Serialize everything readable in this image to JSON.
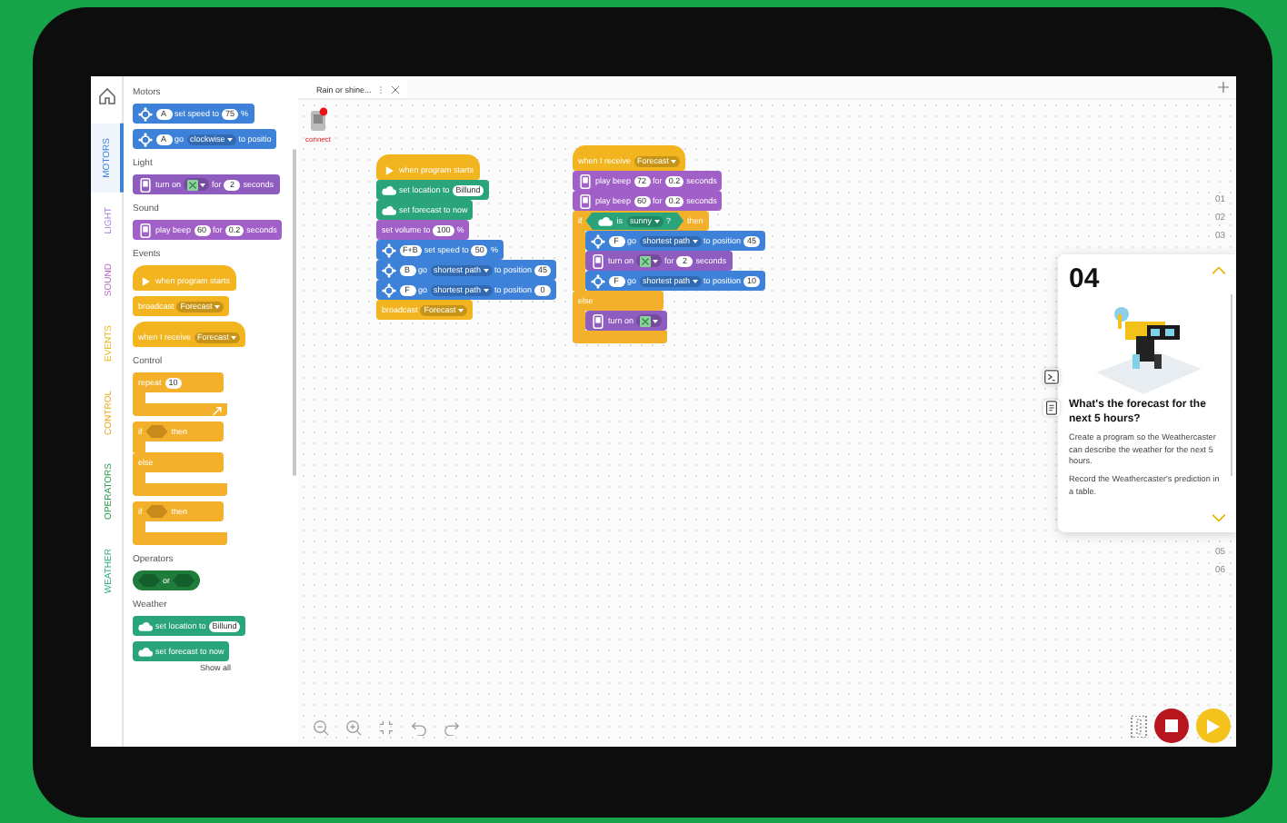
{
  "tab": {
    "title": "Rain or shine..."
  },
  "categories": [
    {
      "label": "MOTORS",
      "selected": true
    },
    {
      "label": "LIGHT",
      "selected": false
    },
    {
      "label": "SOUND",
      "selected": false
    },
    {
      "label": "EVENTS",
      "selected": false
    },
    {
      "label": "CONTROL",
      "selected": false
    },
    {
      "label": "OPERATORS",
      "selected": false
    },
    {
      "label": "WEATHER",
      "selected": false
    }
  ],
  "palette": [
    {
      "title": "Motors",
      "blocks": [
        {
          "kind": "motor",
          "parts": [
            {
              "kind": "icon"
            },
            {
              "kind": "pill",
              "v": "A"
            },
            {
              "kind": "text",
              "v": "set speed to"
            },
            {
              "kind": "pill",
              "v": "75"
            },
            {
              "kind": "text",
              "v": "%"
            }
          ]
        },
        {
          "kind": "motor",
          "parts": [
            {
              "kind": "icon"
            },
            {
              "kind": "pill",
              "v": "A"
            },
            {
              "kind": "text",
              "v": "go"
            },
            {
              "kind": "dd",
              "v": "clockwise"
            },
            {
              "kind": "text",
              "v": "to positio"
            }
          ]
        }
      ]
    },
    {
      "title": "Light",
      "blocks": [
        {
          "kind": "light",
          "parts": [
            {
              "kind": "icon"
            },
            {
              "kind": "text",
              "v": "turn on"
            },
            {
              "kind": "matrix"
            },
            {
              "kind": "text",
              "v": "for"
            },
            {
              "kind": "pill",
              "v": "2"
            },
            {
              "kind": "text",
              "v": "seconds"
            }
          ]
        }
      ]
    },
    {
      "title": "Sound",
      "blocks": [
        {
          "kind": "sound",
          "parts": [
            {
              "kind": "icon"
            },
            {
              "kind": "text",
              "v": "play beep"
            },
            {
              "kind": "pill",
              "v": "60"
            },
            {
              "kind": "text",
              "v": "for"
            },
            {
              "kind": "pill",
              "v": "0.2"
            },
            {
              "kind": "text",
              "v": "seconds"
            }
          ]
        }
      ]
    },
    {
      "title": "Events",
      "blocks": [
        {
          "kind": "hat",
          "parts": [
            {
              "kind": "icon"
            },
            {
              "kind": "text",
              "v": "when program starts"
            }
          ]
        },
        {
          "kind": "event",
          "parts": [
            {
              "kind": "text",
              "v": "broadcast"
            },
            {
              "kind": "dd",
              "v": "Forecast"
            }
          ]
        },
        {
          "kind": "hat",
          "parts": [
            {
              "kind": "text",
              "v": "when I receive"
            },
            {
              "kind": "dd",
              "v": "Forecast"
            }
          ]
        }
      ]
    },
    {
      "title": "Control",
      "blocks": [
        {
          "kind": "c",
          "parts": [
            {
              "kind": "text",
              "v": "repeat"
            },
            {
              "kind": "pill",
              "v": "10"
            }
          ],
          "foot": [
            {
              "kind": "loop"
            }
          ]
        },
        {
          "kind": "c",
          "parts": [
            {
              "kind": "text",
              "v": "if"
            },
            {
              "kind": "hex"
            },
            {
              "kind": "text",
              "v": "then"
            }
          ],
          "else": {
            "parts": [
              {
                "kind": "text",
                "v": "else"
              }
            ]
          }
        },
        {
          "kind": "c",
          "parts": [
            {
              "kind": "text",
              "v": "if"
            },
            {
              "kind": "hex"
            },
            {
              "kind": "text",
              "v": "then"
            }
          ]
        }
      ]
    },
    {
      "title": "Operators",
      "blocks": [
        {
          "kind": "operator",
          "parts": [
            {
              "kind": "hex"
            },
            {
              "kind": "text",
              "v": "or"
            },
            {
              "kind": "hex"
            }
          ]
        }
      ]
    },
    {
      "title": "Weather",
      "blocks": [
        {
          "kind": "weather",
          "parts": [
            {
              "kind": "icon"
            },
            {
              "kind": "text",
              "v": "set location to"
            },
            {
              "kind": "pill",
              "v": "Billund"
            }
          ]
        },
        {
          "kind": "weather",
          "parts": [
            {
              "kind": "icon"
            },
            {
              "kind": "text",
              "v": "set forecast to now"
            }
          ]
        }
      ]
    }
  ],
  "show_all": "Show all",
  "connect": {
    "label": "connect"
  },
  "stacks": [
    [
      {
        "kind": "hat",
        "parts": [
          {
            "kind": "icon"
          },
          {
            "kind": "text",
            "v": "when program starts"
          }
        ]
      },
      {
        "kind": "weather",
        "parts": [
          {
            "kind": "icon"
          },
          {
            "kind": "text",
            "v": "set location to"
          },
          {
            "kind": "pill",
            "v": "Billund"
          }
        ]
      },
      {
        "kind": "weather",
        "parts": [
          {
            "kind": "icon"
          },
          {
            "kind": "text",
            "v": "set forecast to now"
          }
        ]
      },
      {
        "kind": "sound",
        "parts": [
          {
            "kind": "text",
            "v": "set volume to"
          },
          {
            "kind": "pill",
            "v": "100"
          },
          {
            "kind": "text",
            "v": "%"
          }
        ]
      },
      {
        "kind": "motor",
        "parts": [
          {
            "kind": "icon"
          },
          {
            "kind": "pill",
            "v": "F+B"
          },
          {
            "kind": "text",
            "v": "set speed to"
          },
          {
            "kind": "pill",
            "v": "50"
          },
          {
            "kind": "text",
            "v": "%"
          }
        ]
      },
      {
        "kind": "motor",
        "parts": [
          {
            "kind": "icon"
          },
          {
            "kind": "pill",
            "v": "B"
          },
          {
            "kind": "text",
            "v": "go"
          },
          {
            "kind": "dd",
            "v": "shortest path"
          },
          {
            "kind": "text",
            "v": "to position"
          },
          {
            "kind": "pill",
            "v": "45"
          }
        ]
      },
      {
        "kind": "motor",
        "parts": [
          {
            "kind": "icon"
          },
          {
            "kind": "pill",
            "v": "F"
          },
          {
            "kind": "text",
            "v": "go"
          },
          {
            "kind": "dd",
            "v": "shortest path"
          },
          {
            "kind": "text",
            "v": "to position"
          },
          {
            "kind": "pill",
            "v": "0"
          }
        ]
      },
      {
        "kind": "event",
        "parts": [
          {
            "kind": "text",
            "v": "broadcast"
          },
          {
            "kind": "dd",
            "v": "Forecast"
          }
        ]
      }
    ],
    [
      {
        "kind": "hat",
        "parts": [
          {
            "kind": "text",
            "v": "when I receive"
          },
          {
            "kind": "dd",
            "v": "Forecast"
          }
        ]
      },
      {
        "kind": "sound",
        "parts": [
          {
            "kind": "icon"
          },
          {
            "kind": "text",
            "v": "play beep"
          },
          {
            "kind": "pill",
            "v": "72"
          },
          {
            "kind": "text",
            "v": "for"
          },
          {
            "kind": "pill",
            "v": "0.2"
          },
          {
            "kind": "text",
            "v": "seconds"
          }
        ]
      },
      {
        "kind": "sound",
        "parts": [
          {
            "kind": "icon"
          },
          {
            "kind": "text",
            "v": "play beep"
          },
          {
            "kind": "pill",
            "v": "60"
          },
          {
            "kind": "text",
            "v": "for"
          },
          {
            "kind": "pill",
            "v": "0.2"
          },
          {
            "kind": "text",
            "v": "seconds"
          }
        ]
      },
      {
        "kind": "c",
        "parts": [
          {
            "kind": "text",
            "v": "if"
          },
          {
            "kind": "hex",
            "condition": {
              "kind": "weather",
              "parts": [
                {
                  "kind": "icon"
                },
                {
                  "kind": "text",
                  "v": "is"
                },
                {
                  "kind": "dd",
                  "v": "sunny"
                },
                {
                  "kind": "text",
                  "v": "?"
                }
              ]
            }
          },
          {
            "kind": "text",
            "v": "then"
          }
        ],
        "body": [
          {
            "kind": "motor",
            "parts": [
              {
                "kind": "icon"
              },
              {
                "kind": "pill",
                "v": "F"
              },
              {
                "kind": "text",
                "v": "go"
              },
              {
                "kind": "dd",
                "v": "shortest path"
              },
              {
                "kind": "text",
                "v": "to position"
              },
              {
                "kind": "pill",
                "v": "45"
              }
            ]
          },
          {
            "kind": "light",
            "parts": [
              {
                "kind": "icon"
              },
              {
                "kind": "text",
                "v": "turn on"
              },
              {
                "kind": "matrix"
              },
              {
                "kind": "text",
                "v": "for"
              },
              {
                "kind": "pill",
                "v": "2"
              },
              {
                "kind": "text",
                "v": "seconds"
              }
            ]
          },
          {
            "kind": "motor",
            "parts": [
              {
                "kind": "icon"
              },
              {
                "kind": "pill",
                "v": "F"
              },
              {
                "kind": "text",
                "v": "go"
              },
              {
                "kind": "dd",
                "v": "shortest path"
              },
              {
                "kind": "text",
                "v": "to position"
              },
              {
                "kind": "pill",
                "v": "10"
              }
            ]
          }
        ],
        "else": {
          "parts": [
            {
              "kind": "text",
              "v": "else"
            }
          ],
          "body": [
            {
              "kind": "light",
              "parts": [
                {
                  "kind": "icon"
                },
                {
                  "kind": "text",
                  "v": "turn on"
                },
                {
                  "kind": "matrix"
                }
              ]
            }
          ]
        }
      }
    ]
  ],
  "steps_before": [
    "01",
    "02",
    "03"
  ],
  "card": {
    "number": "04",
    "title": "What's the forecast for the next 5 hours?",
    "paragraphs": [
      "Create a program so the Weathercaster can describe the weather for the next 5 hours.",
      "Record the Weathercaster's prediction in a table."
    ]
  },
  "steps_after": [
    "05",
    "06"
  ]
}
